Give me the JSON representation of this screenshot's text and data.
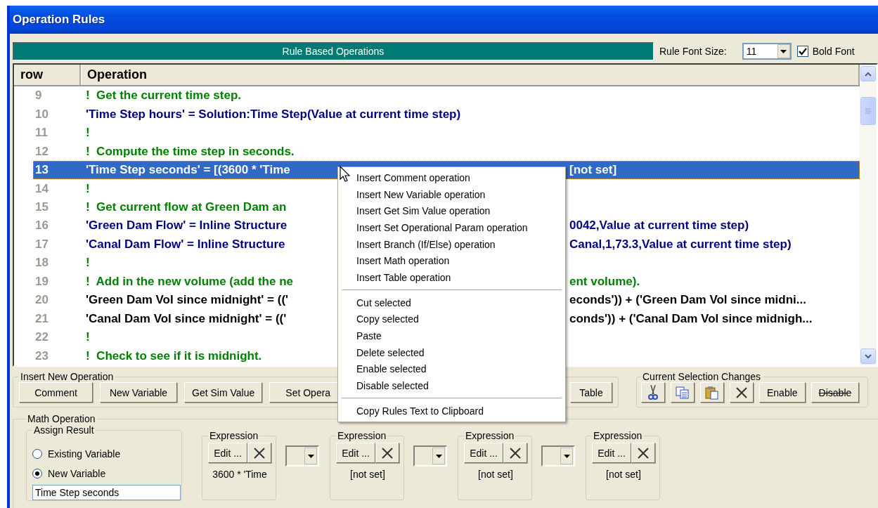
{
  "window": {
    "title": "Operation Rules"
  },
  "toolbar": {
    "banner": "Rule Based Operations",
    "font_size_label": "Rule Font Size:",
    "font_size": "11",
    "bold_font": {
      "label": "Bold Font",
      "checked": true
    }
  },
  "table": {
    "columns": [
      "row",
      "Operation"
    ],
    "rows": [
      {
        "row": "9",
        "kind": "comment",
        "selected": false,
        "text": "!  Get the current time step."
      },
      {
        "row": "10",
        "kind": "sim_value",
        "selected": false,
        "text": "'Time Step hours' = Solution:Time Step(Value at current time step)"
      },
      {
        "row": "11",
        "kind": "comment",
        "selected": false,
        "text": "!"
      },
      {
        "row": "12",
        "kind": "comment",
        "selected": false,
        "text": "!  Compute the time step in seconds."
      },
      {
        "row": "13",
        "kind": "math",
        "selected": true,
        "text": "'Time Step seconds' = [(3600 * 'Time",
        "text_after_menu": "[not set]"
      },
      {
        "row": "14",
        "kind": "comment",
        "selected": false,
        "text": "!"
      },
      {
        "row": "15",
        "kind": "comment",
        "selected": false,
        "text": "!  Get current flow at Green Dam an"
      },
      {
        "row": "16",
        "kind": "sim_value",
        "selected": false,
        "text": "'Green Dam Flow' = Inline Structure",
        "text_after_menu": "0042,Value at current time step)"
      },
      {
        "row": "17",
        "kind": "sim_value",
        "selected": false,
        "text": "'Canal Dam Flow' = Inline Structure",
        "text_after_menu": "Canal,1,73.3,Value at current time step)"
      },
      {
        "row": "18",
        "kind": "comment",
        "selected": false,
        "text": "!"
      },
      {
        "row": "19",
        "kind": "comment",
        "selected": false,
        "text": "!  Add in the new volume (add the ne",
        "text_after_menu": "ent volume)."
      },
      {
        "row": "20",
        "kind": "math",
        "selected": false,
        "text": "'Green Dam Vol since midnight' = (('",
        "text_after_menu": "econds')) + ('Green Dam Vol since midni..."
      },
      {
        "row": "21",
        "kind": "math",
        "selected": false,
        "text": "'Canal Dam Vol since midnight' = (('",
        "text_after_menu": "conds')) + ('Canal Dam Vol since midnigh..."
      },
      {
        "row": "22",
        "kind": "comment",
        "selected": false,
        "text": "!"
      },
      {
        "row": "23",
        "kind": "comment",
        "selected": false,
        "text": "!  Check to see if it is midnight."
      }
    ]
  },
  "context_menu": {
    "groups": [
      [
        "Insert Comment operation",
        "Insert New Variable operation",
        "Insert Get Sim Value operation",
        "Insert Set Operational Param operation",
        "Insert Branch (If/Else) operation",
        "Insert Math operation",
        "Insert Table operation"
      ],
      [
        "Cut selected",
        "Copy selected",
        "Paste",
        "Delete selected",
        "Enable selected",
        "Disable selected"
      ],
      [
        "Copy Rules Text to Clipboard"
      ]
    ]
  },
  "insert_new_operation": {
    "title": "Insert New Operation",
    "buttons": [
      "Comment",
      "New Variable",
      "Get Sim Value",
      "Set Opera"
    ],
    "last_button": "Table"
  },
  "current_selection_changes": {
    "title": "Current Selection Changes",
    "buttons": [
      {
        "kind": "cut"
      },
      {
        "kind": "copy"
      },
      {
        "kind": "paste"
      },
      {
        "kind": "delete"
      },
      {
        "kind": "text",
        "label": "Enable"
      },
      {
        "kind": "struck",
        "label": "Disable"
      }
    ]
  },
  "math_operation": {
    "title": "Math Operation",
    "assign_result": {
      "title": "Assign Result",
      "options": [
        {
          "label": "Existing Variable",
          "selected": false
        },
        {
          "label": "New Variable",
          "selected": true
        }
      ],
      "name_value": "Time Step seconds"
    },
    "expressions": [
      {
        "title": "Expression",
        "edit_label": "Edit ...",
        "value": "3600 * 'Time"
      },
      {
        "title": "Expression",
        "edit_label": "Edit ...",
        "value": "[not set]"
      },
      {
        "title": "Expression",
        "edit_label": "Edit ...",
        "value": "[not set]"
      },
      {
        "title": "Expression",
        "edit_label": "Edit ...",
        "value": "[not set]"
      }
    ]
  }
}
